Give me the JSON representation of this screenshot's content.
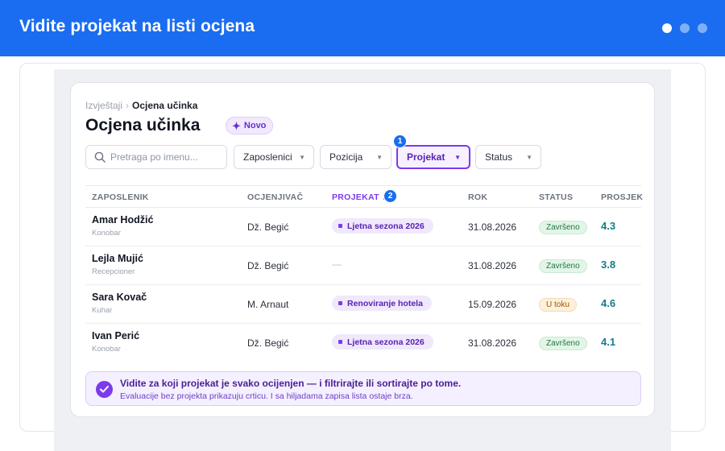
{
  "banner": {
    "title": "Vidite projekat na listi ocjena",
    "dots": 3,
    "active_dot": 0
  },
  "breadcrumb": {
    "parent": "Izvještaji",
    "separator": "›",
    "current": "Ocjena učinka"
  },
  "page": {
    "title": "Ocjena učinka",
    "new_badge": "Novo"
  },
  "filters": {
    "search_placeholder": "Pretraga po imenu...",
    "employees": "Zaposlenici",
    "position": "Pozicija",
    "project": "Projekat",
    "status": "Status",
    "project_step": "1"
  },
  "table": {
    "headers": {
      "employee": "ZAPOSLENIK",
      "reviewer": "OCJENJIVAČ",
      "project": "PROJEKAT ↓",
      "deadline": "ROK",
      "status": "STATUS",
      "average": "PROSJEK"
    },
    "sort_step": "2",
    "rows": [
      {
        "name": "Amar Hodžić",
        "role": "Konobar",
        "reviewer": "Dž. Begić",
        "project": "Ljetna sezona 2026",
        "deadline": "31.08.2026",
        "status": "Završeno",
        "average": "4.3"
      },
      {
        "name": "Lejla Mujić",
        "role": "Recepcioner",
        "reviewer": "Dž. Begić",
        "project": "—",
        "deadline": "31.08.2026",
        "status": "Završeno",
        "average": "3.8"
      },
      {
        "name": "Sara Kovač",
        "role": "Kuhar",
        "reviewer": "M. Arnaut",
        "project": "Renoviranje hotela",
        "deadline": "15.09.2026",
        "status": "U toku",
        "average": "4.6"
      },
      {
        "name": "Ivan Perić",
        "role": "Konobar",
        "reviewer": "Dž. Begić",
        "project": "Ljetna sezona 2026",
        "deadline": "31.08.2026",
        "status": "Završeno",
        "average": "4.1"
      }
    ]
  },
  "info": {
    "headline": "Vidite za koji projekat je svako ocijenjen — i filtrirajte ili sortirajte po tome.",
    "detail": "Evaluacije bez projekta prikazuju crticu. I sa hiljadama zapisa lista ostaje brza."
  },
  "colors": {
    "banner": "#1a6df0",
    "accent": "#7c3aed",
    "average": "#137c8b",
    "status_done": "#1e7a3d",
    "status_progress": "#9a5a00"
  }
}
